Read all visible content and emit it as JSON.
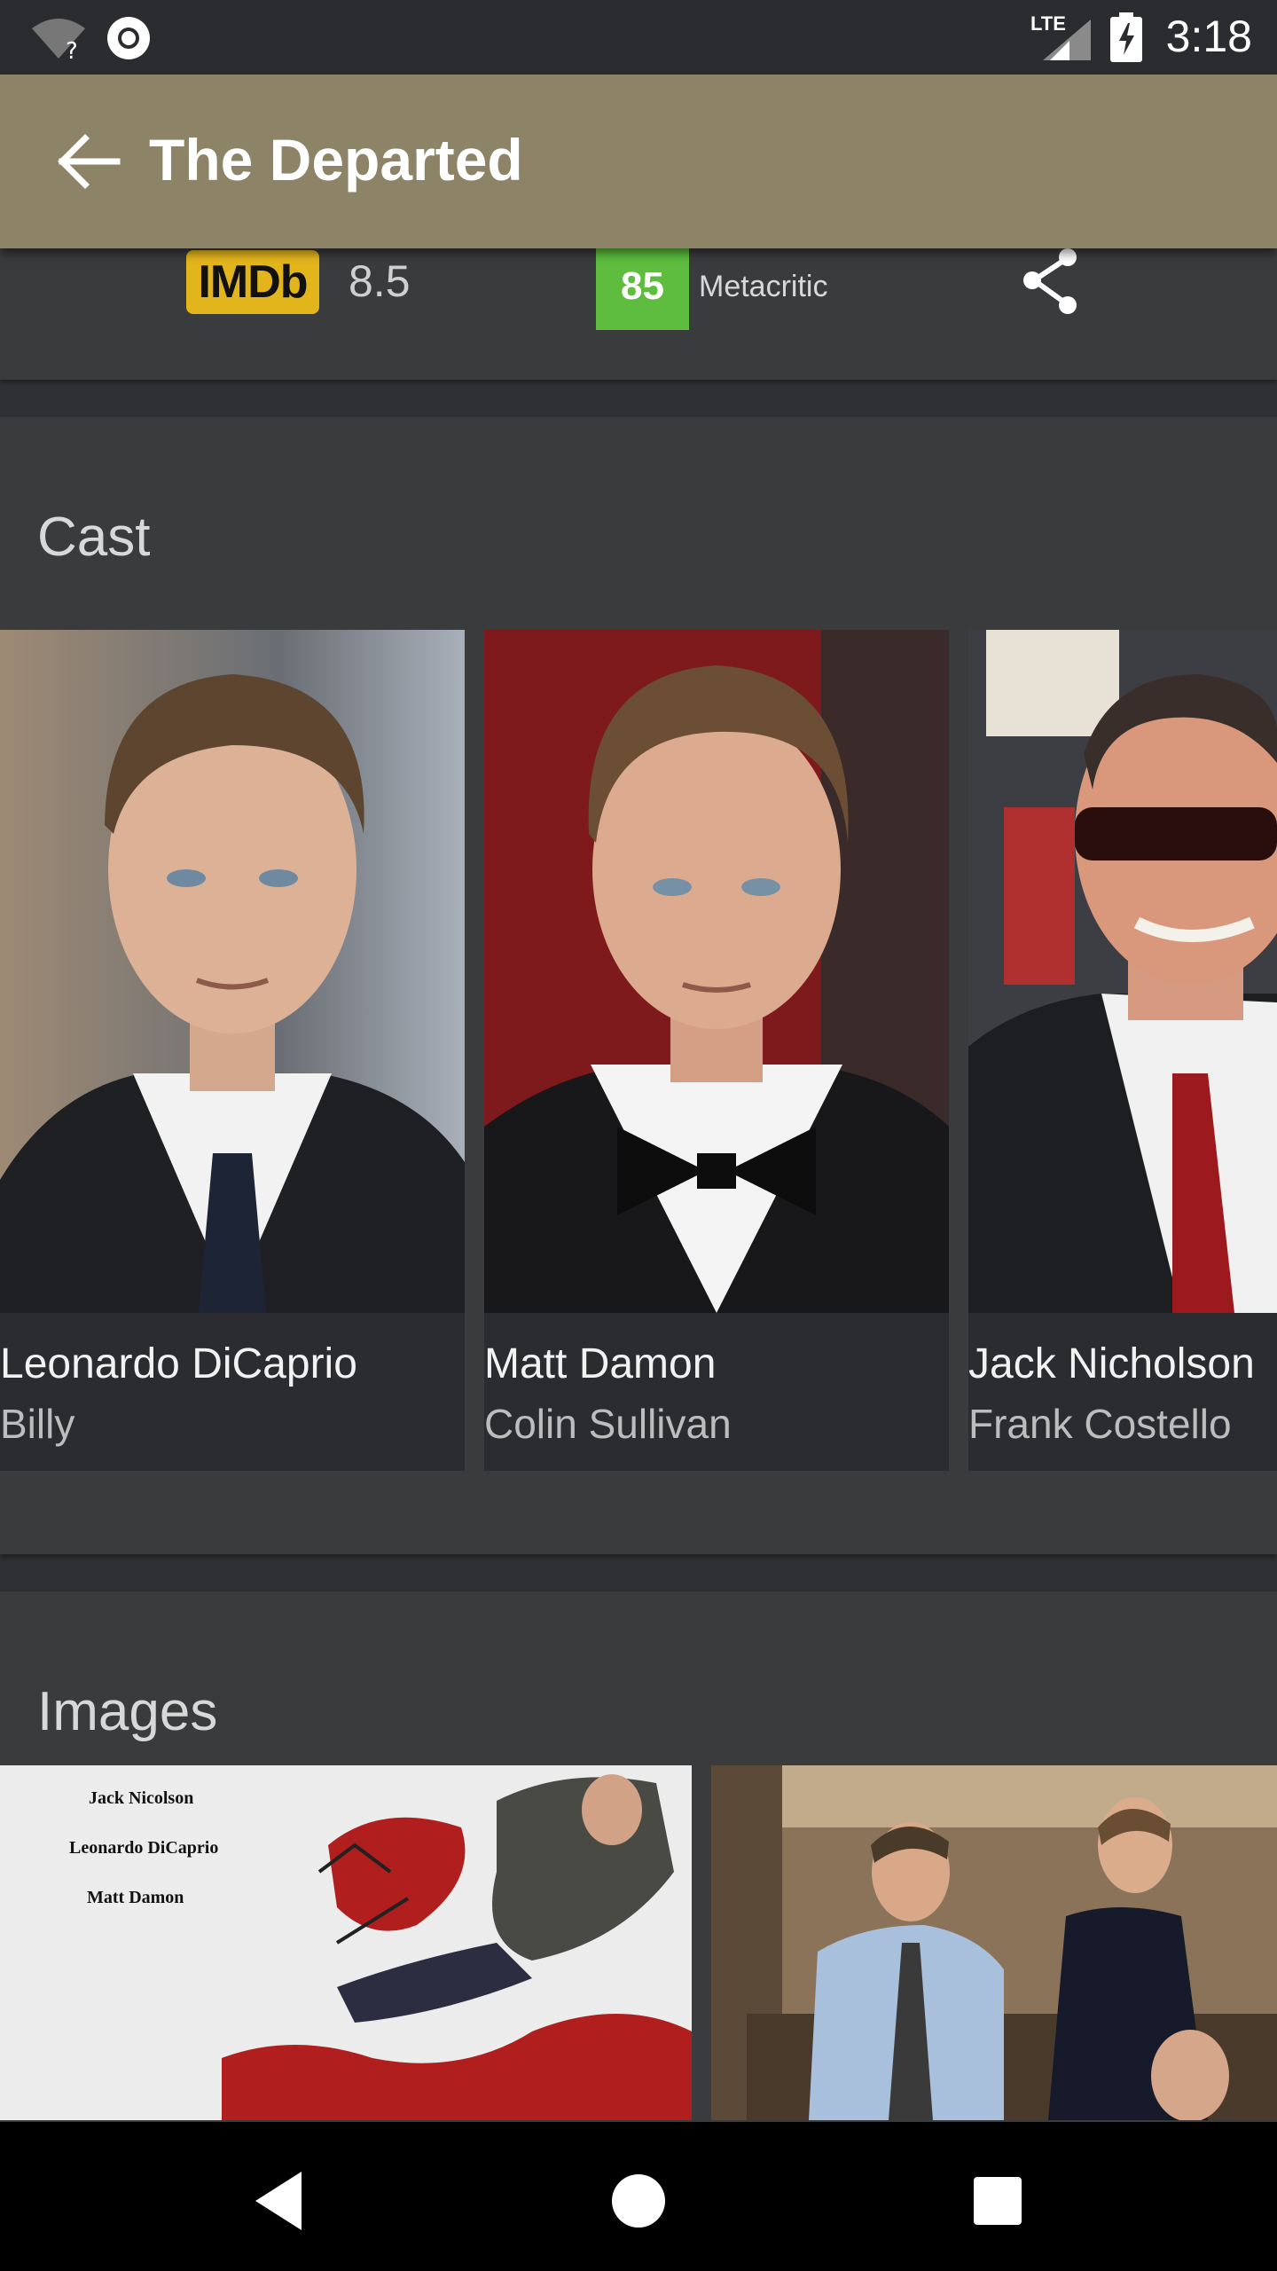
{
  "status_bar": {
    "time": "3:18",
    "network": "LTE",
    "icons": [
      "wifi-unknown-icon",
      "sync-icon",
      "lte-signal-icon",
      "battery-charging-icon"
    ]
  },
  "app_bar": {
    "title": "The Departed",
    "back_icon": "arrow-left-icon"
  },
  "ratings": {
    "imdb_label": "IMDb",
    "imdb_score": "8.5",
    "metacritic_score": "85",
    "metacritic_label": "Metacritic",
    "share_icon": "share-icon"
  },
  "cast": {
    "heading": "Cast",
    "items": [
      {
        "name": "Leonardo DiCaprio",
        "role": "Billy"
      },
      {
        "name": "Matt Damon",
        "role": "Colin Sullivan"
      },
      {
        "name": "Jack Nicholson",
        "role": "Frank Costello"
      }
    ]
  },
  "images": {
    "heading": "Images",
    "poster_credits": [
      "Jack Nicolson",
      "Leonardo DiCaprio",
      "Matt Damon"
    ]
  },
  "nav_bar": {
    "icons": [
      "back-triangle-icon",
      "home-circle-icon",
      "recents-square-icon"
    ]
  },
  "colors": {
    "app_bar": "#8d8468",
    "background": "#2f3033",
    "card": "#3a3b3d",
    "imdb": "#e3b51c",
    "metacritic": "#5ebd3e"
  }
}
